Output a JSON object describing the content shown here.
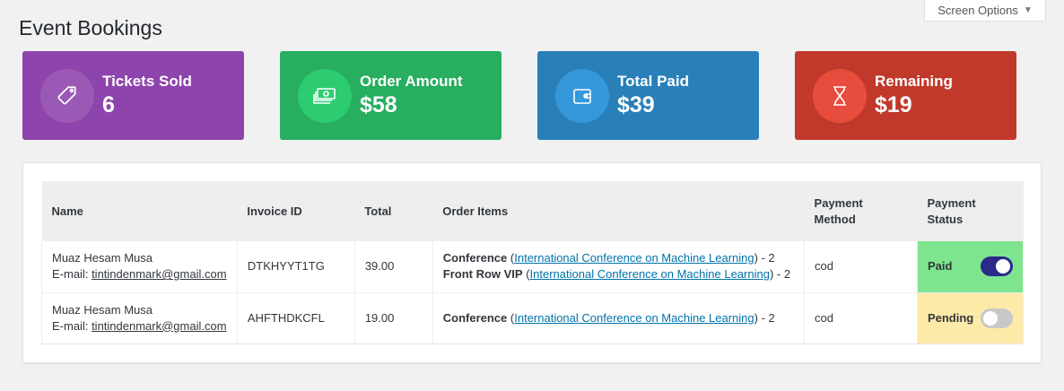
{
  "page": {
    "title": "Event Bookings",
    "screen_options": "Screen Options"
  },
  "colors": {
    "purple": "#8e44ad",
    "green": "#27ae60",
    "blue": "#2980b9",
    "red": "#c0392b"
  },
  "cards": [
    {
      "label": "Tickets Sold",
      "value": "6",
      "icon": "tag-icon"
    },
    {
      "label": "Order Amount",
      "value": "$58",
      "icon": "money-icon"
    },
    {
      "label": "Total Paid",
      "value": "$39",
      "icon": "wallet-icon"
    },
    {
      "label": "Remaining",
      "value": "$19",
      "icon": "hourglass-icon"
    }
  ],
  "table": {
    "headers": [
      "Name",
      "Invoice ID",
      "Total",
      "Order Items",
      "Payment Method",
      "Payment Status"
    ],
    "rows": [
      {
        "name": "Muaz Hesam Musa",
        "email_prefix": "E-mail: ",
        "email": "tintindenmark@gmail.com",
        "invoice": "DTKHYYT1TG",
        "total": "39.00",
        "items": [
          {
            "type": "Conference",
            "event": "International Conference on Machine Learning",
            "qty": "2"
          },
          {
            "type": "Front Row VIP",
            "event": "International Conference on Machine Learning",
            "qty": "2"
          }
        ],
        "method": "cod",
        "status": "Paid",
        "status_on": true
      },
      {
        "name": "Muaz Hesam Musa",
        "email_prefix": "E-mail: ",
        "email": "tintindenmark@gmail.com",
        "invoice": "AHFTHDKCFL",
        "total": "19.00",
        "items": [
          {
            "type": "Conference",
            "event": "International Conference on Machine Learning",
            "qty": "2"
          }
        ],
        "method": "cod",
        "status": "Pending",
        "status_on": false
      }
    ]
  }
}
